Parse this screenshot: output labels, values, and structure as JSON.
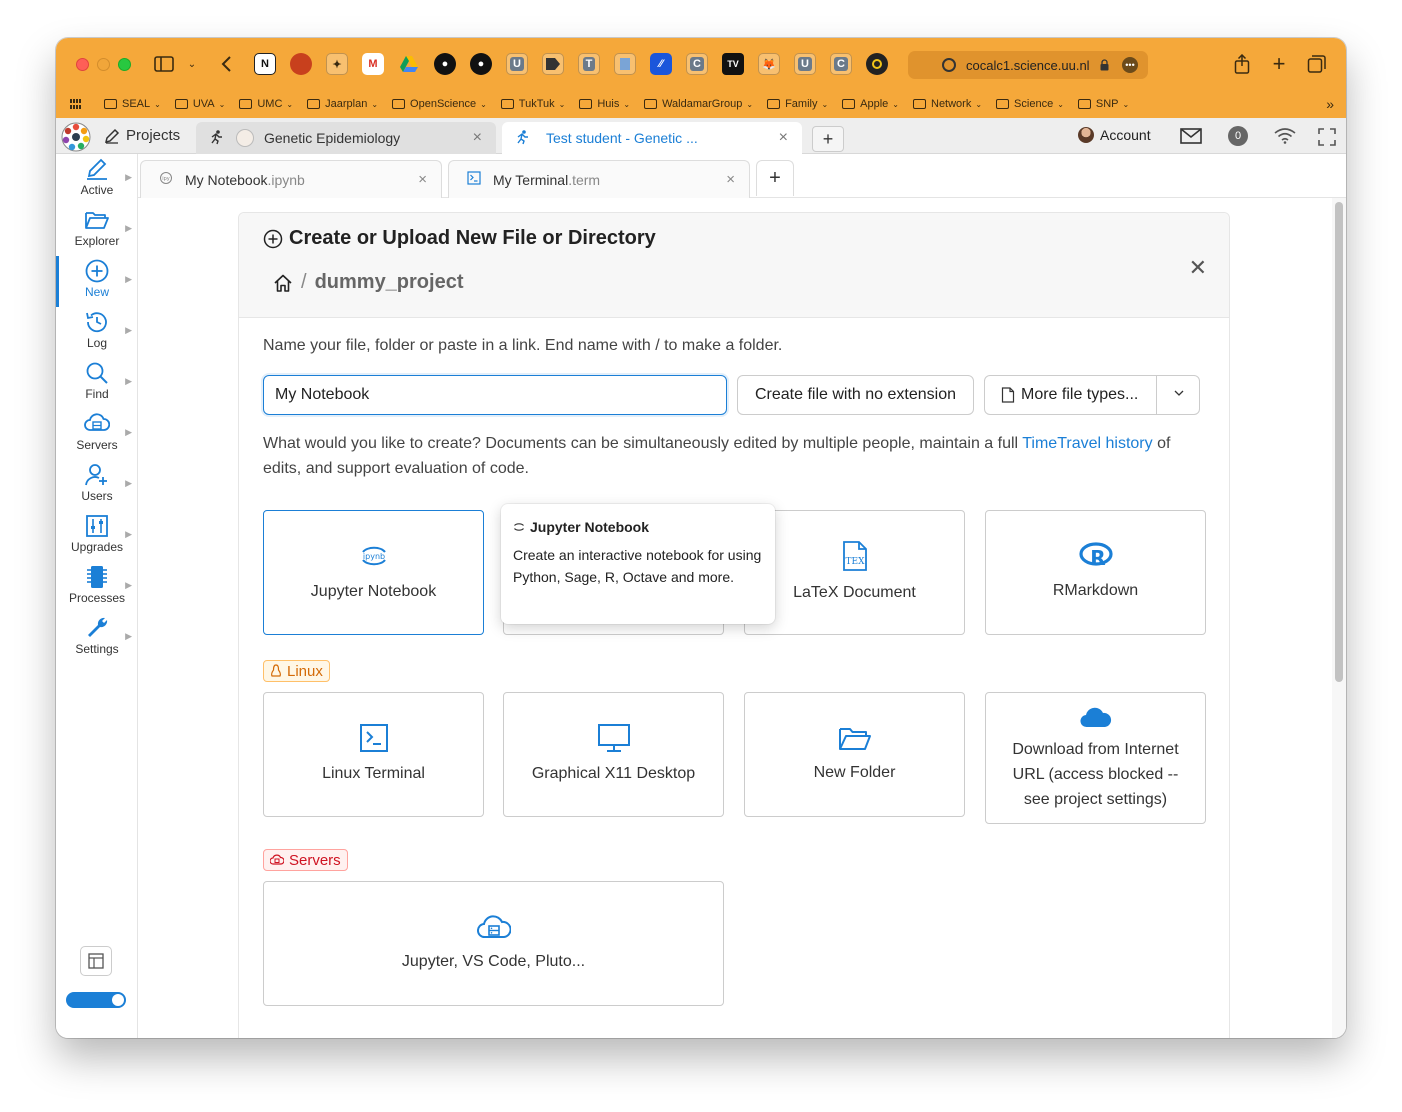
{
  "browser": {
    "url": "cocalc1.science.uu.nl",
    "bookmarks": [
      "SEAL",
      "UVA",
      "UMC",
      "Jaarplan",
      "OpenScience",
      "TukTuk",
      "Huis",
      "WaldamarGroup",
      "Family",
      "Apple",
      "Network",
      "Science",
      "SNP"
    ],
    "favicons": [
      "N",
      "U",
      "T",
      "C",
      "TV",
      "U",
      "C"
    ]
  },
  "topbar": {
    "projects_label": "Projects",
    "tabs": [
      {
        "label": "Genetic Epidemiology",
        "active": false
      },
      {
        "label": "Test student - Genetic ...",
        "active": true
      }
    ],
    "account_label": "Account",
    "notifications_count": "0"
  },
  "sidebar": {
    "items": [
      {
        "label": "Active",
        "icon": "pencil-icon"
      },
      {
        "label": "Explorer",
        "icon": "folder-open-icon"
      },
      {
        "label": "New",
        "icon": "plus-circle-icon",
        "active": true
      },
      {
        "label": "Log",
        "icon": "history-icon"
      },
      {
        "label": "Find",
        "icon": "search-icon"
      },
      {
        "label": "Servers",
        "icon": "cloud-server-icon"
      },
      {
        "label": "Users",
        "icon": "user-add-icon"
      },
      {
        "label": "Upgrades",
        "icon": "sliders-icon"
      },
      {
        "label": "Processes",
        "icon": "microchip-icon"
      },
      {
        "label": "Settings",
        "icon": "wrench-icon"
      }
    ]
  },
  "file_tabs": [
    {
      "name": "My Notebook",
      "ext": ".ipynb"
    },
    {
      "name": "My Terminal",
      "ext": ".term"
    }
  ],
  "panel": {
    "title": "Create or Upload New File or Directory",
    "breadcrumb_sep": "/",
    "breadcrumb_dir": "dummy_project",
    "hint": "Name your file, folder or paste in a link. End name with / to make a folder.",
    "input_value": "My Notebook",
    "no_ext_button": "Create file with no extension",
    "more_types_button": "More file types...",
    "desc_before": "What would you like to create? Documents can be simultaneously edited by multiple people, maintain a full ",
    "desc_link": "TimeTravel history",
    "desc_after": " of edits, and support evaluation of code.",
    "tiles_main": [
      {
        "label": "Jupyter Notebook",
        "icon": "jupyter-icon"
      },
      {
        "label": "LaTeX Document",
        "icon": "tex-icon"
      },
      {
        "label": "RMarkdown",
        "icon": "r-icon"
      }
    ],
    "linux_tag": "Linux",
    "tiles_linux": [
      {
        "label": "Linux Terminal",
        "icon": "terminal-icon"
      },
      {
        "label": "Graphical X11 Desktop",
        "icon": "desktop-icon"
      },
      {
        "label": "New Folder",
        "icon": "folder-open-icon"
      },
      {
        "label": "Download from Internet URL (access blocked -- see project settings)",
        "icon": "cloud-icon"
      }
    ],
    "servers_tag": "Servers",
    "servers_tile": "Jupyter, VS Code, Pluto...",
    "tooltip": {
      "title": "Jupyter Notebook",
      "body": "Create an interactive notebook for using Python, Sage, R, Octave and more."
    }
  },
  "colors": {
    "browser_chrome": "#f5a83a",
    "accent": "#1b7fd6",
    "linux_tag": "#d46b08",
    "servers_tag": "#cf1322"
  }
}
